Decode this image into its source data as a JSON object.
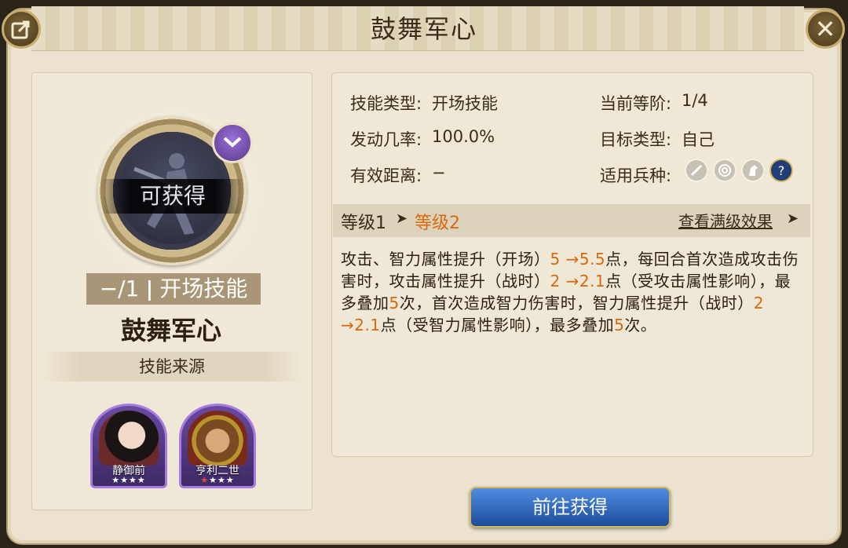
{
  "header": {
    "title": "鼓舞军心"
  },
  "skill": {
    "badge": "可获得",
    "level_tag": "−/1 ǀ 开场技能",
    "name": "鼓舞军心",
    "source_label": "技能来源"
  },
  "heroes": [
    {
      "name": "静御前",
      "stars": 4,
      "red_stars": 0
    },
    {
      "name": "亨利二世",
      "stars": 4,
      "red_stars": 1
    }
  ],
  "info": {
    "skill_type_label": "技能类型:",
    "skill_type_value": "开场技能",
    "rank_label": "当前等阶:",
    "rank_value": "1/4",
    "trigger_label": "发动几率:",
    "trigger_value": "100.0%",
    "target_label": "目标类型:",
    "target_value": "自己",
    "range_label": "有效距离:",
    "range_value": "−",
    "troop_label": "适用兵种:",
    "troop_icons": [
      "sword-icon",
      "target-icon",
      "horse-icon",
      "question-icon"
    ]
  },
  "levels": {
    "from": "等级1",
    "to": "等级2",
    "max_link": "查看满级效果"
  },
  "description": {
    "p1": "攻击、智力属性提升（开场）",
    "v1": "5 →5.5",
    "p2": "点，每回合首次造成攻击伤害时，攻击属性提升（战时）",
    "v2": "2 →2.1",
    "p3": "点（受攻击属性影响），最多叠加",
    "v3": "5",
    "p4": "次，首次造成智力伤害时，智力属性提升（战时）",
    "v4": "2 →2.1",
    "p5": "点（受智力属性影响），最多叠加",
    "v5": "5",
    "p6": "次。"
  },
  "action": {
    "go_label": "前往获得"
  },
  "colors": {
    "accent_orange": "#d9690f",
    "button_blue": "#1d4d9c",
    "panel_bg": "#ebe3cf"
  }
}
